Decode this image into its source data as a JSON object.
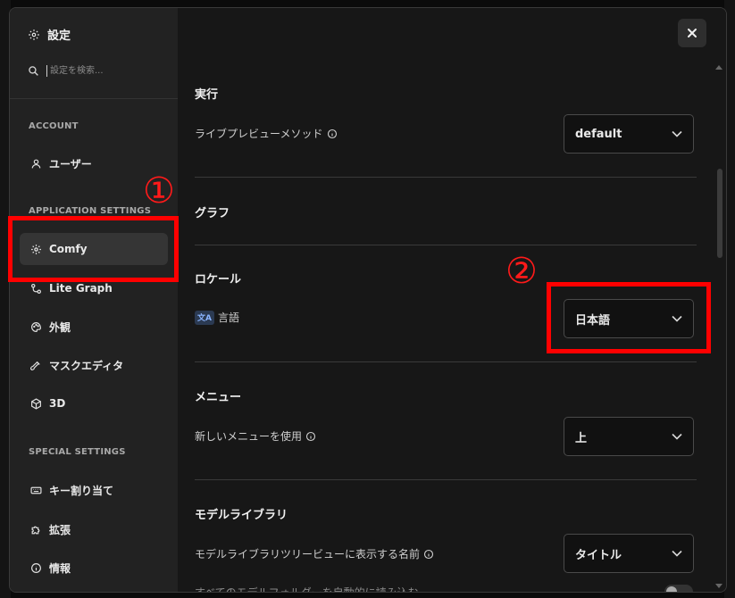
{
  "sidebar": {
    "title": "設定",
    "search_placeholder": "設定を検索...",
    "sections": {
      "account": "ACCOUNT",
      "application": "APPLICATION SETTINGS",
      "special": "SPECIAL SETTINGS"
    },
    "items": {
      "user": "ユーザー",
      "comfy": "Comfy",
      "lite_graph": "Lite Graph",
      "appearance": "外観",
      "mask_editor": "マスクエディタ",
      "three_d": "3D",
      "keybinding": "キー割り当て",
      "extensions": "拡張",
      "about": "情報"
    }
  },
  "main": {
    "groups": {
      "execution": {
        "title": "実行",
        "setting_label": "ライブプレビューメソッド",
        "value": "default"
      },
      "graph": {
        "title": "グラフ"
      },
      "locale": {
        "title": "ロケール",
        "setting_label": "言語",
        "badge": "文A",
        "value": "日本語"
      },
      "menu": {
        "title": "メニュー",
        "setting_label": "新しいメニューを使用",
        "value": "上"
      },
      "model_library": {
        "title": "モデルライブラリ",
        "setting_label": "モデルライブラリツリービューに表示する名前",
        "value": "タイトル",
        "cutoff_label": "すべてのモデルフォルダーを自動的に読み込む"
      }
    }
  },
  "annotations": {
    "marker_1": "①",
    "marker_2": "②"
  },
  "colors": {
    "highlight": "#ff0000",
    "sidebar_bg": "#222222",
    "main_bg": "#171717"
  }
}
